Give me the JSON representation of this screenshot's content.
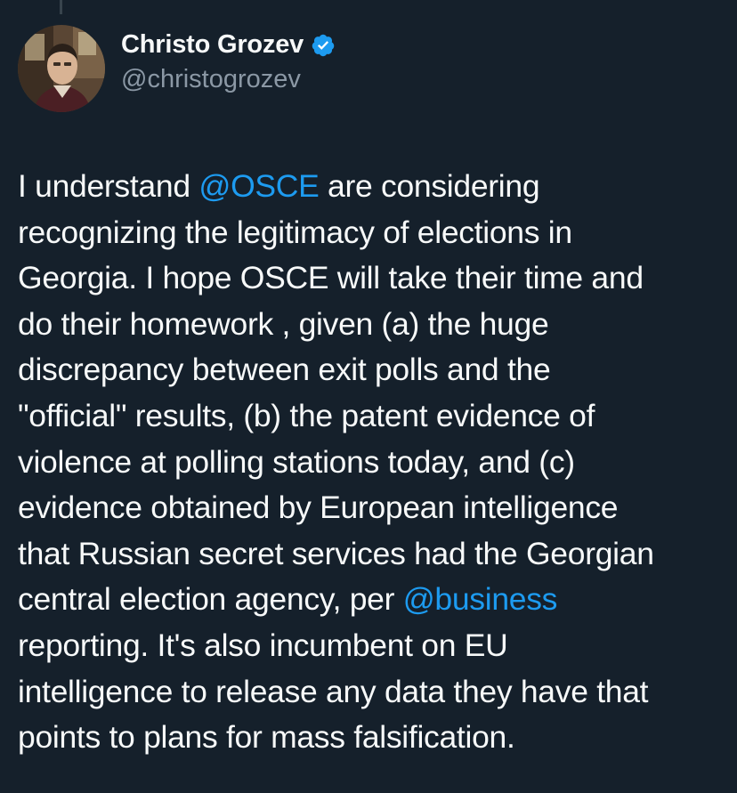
{
  "author": {
    "display_name": "Christo Grozev",
    "handle": "@christogrozev",
    "verified": true
  },
  "tweet": {
    "lines": [
      [
        {
          "text": "I understand "
        },
        {
          "text": "@OSCE",
          "mention": true
        },
        {
          "text": " are considering"
        }
      ],
      [
        {
          "text": "recognizing the legitimacy of elections in"
        }
      ],
      [
        {
          "text": "Georgia. I hope OSCE will take their time and"
        }
      ],
      [
        {
          "text": "do their homework , given (a) the huge"
        }
      ],
      [
        {
          "text": "discrepancy between exit polls and the"
        }
      ],
      [
        {
          "text": "\"official\" results, (b) the patent evidence of"
        }
      ],
      [
        {
          "text": "violence at polling stations today, and (c)"
        }
      ],
      [
        {
          "text": "evidence obtained by European intelligence"
        }
      ],
      [
        {
          "text": "that Russian secret services had the Georgian"
        }
      ],
      [
        {
          "text": "central election agency, per "
        },
        {
          "text": "@business",
          "mention": true
        }
      ],
      [
        {
          "text": "reporting.  It's also incumbent on EU"
        }
      ],
      [
        {
          "text": "intelligence to release any data they have that"
        }
      ],
      [
        {
          "text": "points to plans for mass falsification."
        }
      ]
    ]
  },
  "colors": {
    "background": "#15202b",
    "text": "#f7f9f9",
    "secondary_text": "#8b98a5",
    "link": "#1d9bf0",
    "verified_badge": "#1d9bf0"
  },
  "icons": {
    "verified": "verified-badge-icon",
    "avatar": "profile-photo"
  }
}
